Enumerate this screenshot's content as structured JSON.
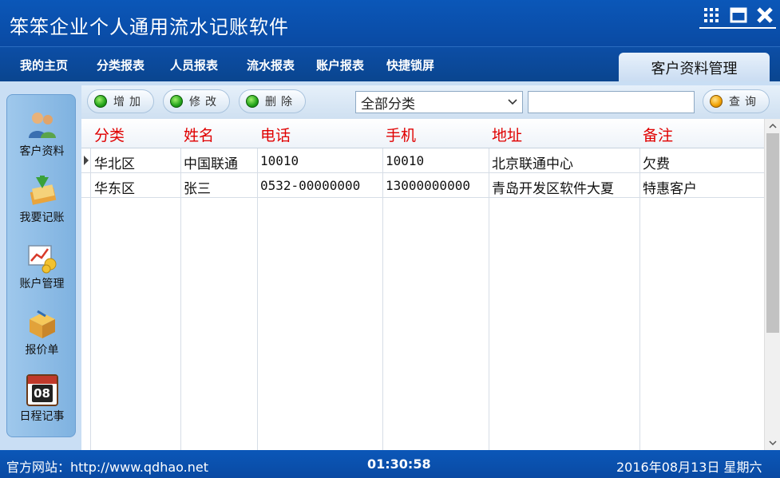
{
  "window": {
    "title": "笨笨企业个人通用流水记账软件"
  },
  "nav": {
    "items": [
      "我的主页",
      "分类报表",
      "人员报表",
      "流水报表",
      "账户报表",
      "快捷锁屏"
    ],
    "active_tab": "客户资料管理"
  },
  "sidebar": {
    "items": [
      {
        "label": "客户资料",
        "icon": "customers-icon"
      },
      {
        "label": "我要记账",
        "icon": "bookkeeping-icon"
      },
      {
        "label": "账户管理",
        "icon": "account-chart-icon"
      },
      {
        "label": "报价单",
        "icon": "package-icon"
      },
      {
        "label": "日程记事",
        "icon": "calendar-icon"
      }
    ],
    "calendar_day": "08"
  },
  "toolbar": {
    "add_label": "增加",
    "edit_label": "修改",
    "delete_label": "删除",
    "category_selected": "全部分类",
    "search_value": "",
    "query_label": "查询"
  },
  "table": {
    "columns": [
      "分类",
      "姓名",
      "电话",
      "手机",
      "地址",
      "备注"
    ],
    "rows": [
      [
        "华北区",
        "中国联通",
        "10010",
        "10010",
        "北京联通中心",
        "欠费"
      ],
      [
        "华东区",
        "张三",
        "0532-00000000",
        "13000000000",
        "青岛开发区软件大夏",
        "特惠客户"
      ]
    ]
  },
  "status": {
    "site": "官方网站：http://www.qdhao.net",
    "time": "01:30:58",
    "date": "2016年08月13日 星期六"
  },
  "colors": {
    "brand_blue": "#0a4aa3",
    "header_red": "#e00000",
    "panel_light": "#c9def4"
  }
}
